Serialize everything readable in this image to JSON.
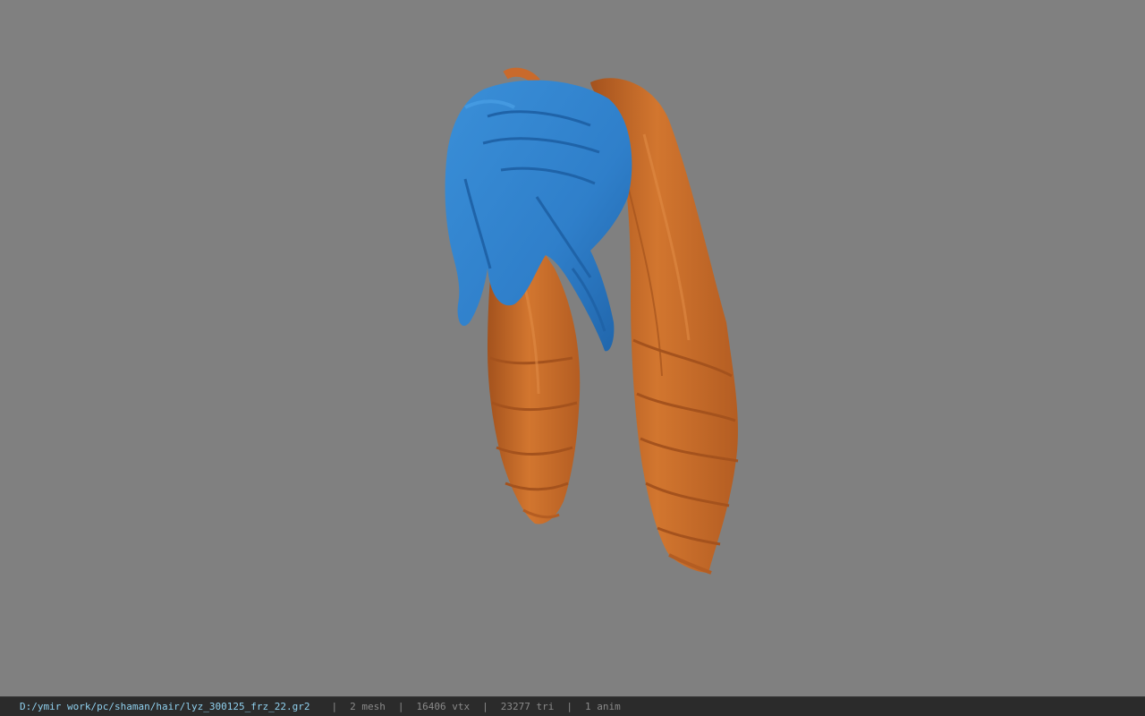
{
  "viewport": {
    "background_color": "#808080",
    "model_label": "hair model viewport",
    "mesh_colors": {
      "front_hair": "#2f7fca",
      "front_hair_shade": "#1f63a8",
      "ponytails": "#c96a2c",
      "ponytails_shade": "#a4521d"
    }
  },
  "statusbar": {
    "file_path": "D:/ymir work/pc/shaman/hair/lyz_300125_frz_22.gr2",
    "separator": "|",
    "mesh_count": "2 mesh",
    "vertex_count": "16406 vtx",
    "triangle_count": "23277 tri",
    "anim_count": "1 anim",
    "path_color": "#8fd0ee",
    "background_color": "#2b2b2b"
  }
}
